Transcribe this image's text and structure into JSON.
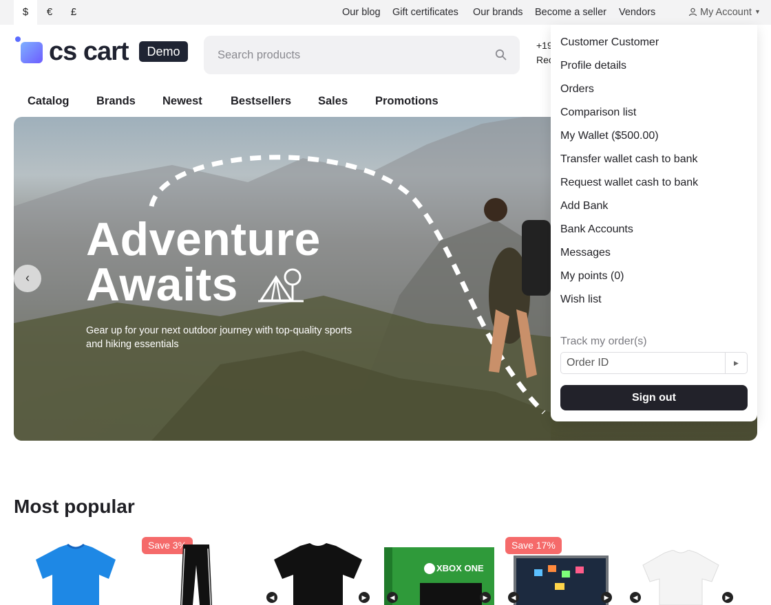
{
  "topbar": {
    "currencies": [
      "$",
      "€",
      "£"
    ],
    "links": [
      "Our blog",
      "Gift certificates",
      "Our brands",
      "Become a seller",
      "Vendors"
    ],
    "account_label": "My Account"
  },
  "header": {
    "logo_text": "cs cart",
    "demo_badge": "Demo",
    "search_placeholder": "Search products",
    "phone_partial": "+19",
    "request_partial": "Rec"
  },
  "nav": [
    "Catalog",
    "Brands",
    "Newest",
    "Bestsellers",
    "Sales",
    "Promotions"
  ],
  "hero": {
    "title_line1": "Adventure",
    "title_line2": "Awaits",
    "subtitle": "Gear up for your next outdoor journey with top-quality sports and hiking essentials"
  },
  "dropdown": {
    "items": [
      "Customer Customer",
      "Profile details",
      "Orders",
      "Comparison list",
      "My Wallet ($500.00)",
      "Transfer wallet cash to bank",
      "Request wallet cash to bank",
      "Add Bank",
      "Bank Accounts",
      "Messages",
      "My points (0)",
      "Wish list"
    ],
    "track_label": "Track my order(s)",
    "order_placeholder": "Order ID",
    "sign_out": "Sign out"
  },
  "popular": {
    "title": "Most popular",
    "badges": [
      "Save 3%",
      "Save 17%"
    ],
    "xbox_text": "XBOX ONE"
  },
  "colors": {
    "accent_dark": "#22222a",
    "badge_red": "#f56a6a",
    "logo_blue": "#5b6cff"
  }
}
